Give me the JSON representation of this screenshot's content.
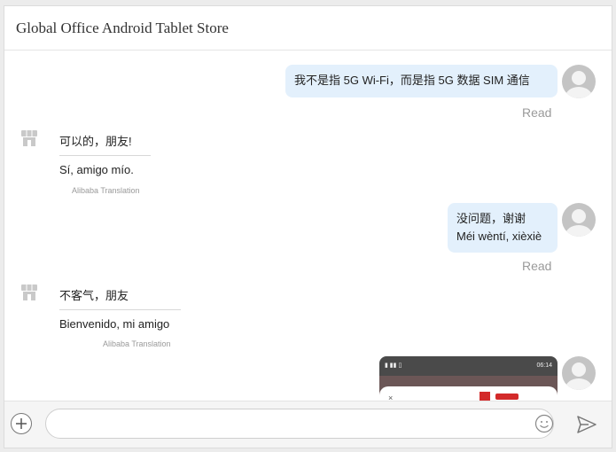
{
  "header": {
    "title": "Global Office Android Tablet Store"
  },
  "messages": [
    {
      "side": "right",
      "lines": [
        "我不是指 5G Wi-Fi，而是指 5G 数据 SIM 通信"
      ],
      "status": "Read"
    },
    {
      "side": "left",
      "original": "可以的，朋友!",
      "translation": "Sí, amigo mío.",
      "note": "Alibaba Translation"
    },
    {
      "side": "right",
      "lines": [
        "没问题，谢谢",
        "Méi wèntí, xièxiè"
      ],
      "status": "Read"
    },
    {
      "side": "left",
      "original": "不客气，朋友",
      "translation": "Bienvenido, mi amigo",
      "note": "Alibaba Translation"
    },
    {
      "side": "right",
      "type": "image",
      "time": "06:14",
      "close": "×"
    }
  ],
  "input": {
    "placeholder": "",
    "value": ""
  },
  "icons": {
    "add": "plus-icon",
    "emoji": "smiley-icon",
    "send": "send-icon",
    "shop": "store-icon",
    "avatar": "user-avatar"
  },
  "colors": {
    "bubble_right": "#e3f0fc",
    "accent_red": "#d32a2a"
  }
}
